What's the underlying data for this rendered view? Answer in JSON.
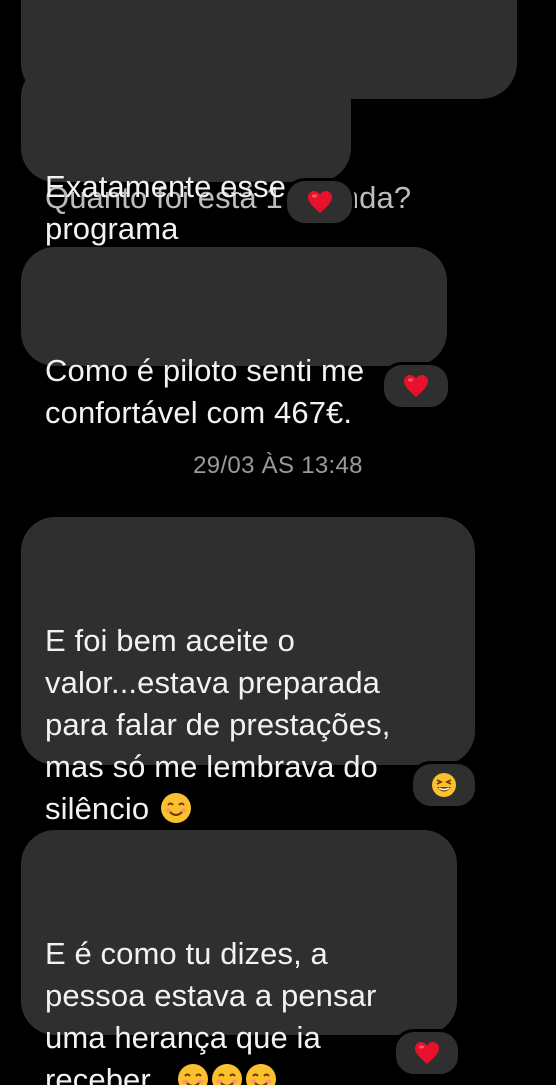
{
  "messages": [
    {
      "text_line_cut": "Quanto foi está 1a venda?"
    },
    {
      "text": "Exatamente esse\nprograma",
      "reaction": "heart-icon"
    },
    {
      "text": "Como é piloto senti me\nconfortável com 467€.",
      "reaction": "heart-icon"
    },
    {
      "text": "E foi bem aceite o\nvalor...estava preparada\npara falar de prestações,\nmas só me lembrava do\nsilêncio",
      "emoji": "smiling-face-icon",
      "reaction": "laughing-face-icon"
    },
    {
      "text": "E é como tu dizes, a\npessoa estava a pensar\numa herança que ia\nreceber...",
      "emoji_count": 3,
      "reaction": "heart-icon"
    }
  ],
  "timestamp": "29/03 ÀS 13:48",
  "colors": {
    "background": "#000000",
    "bubble": "#2f2f2f",
    "heart": "#e8112d"
  }
}
